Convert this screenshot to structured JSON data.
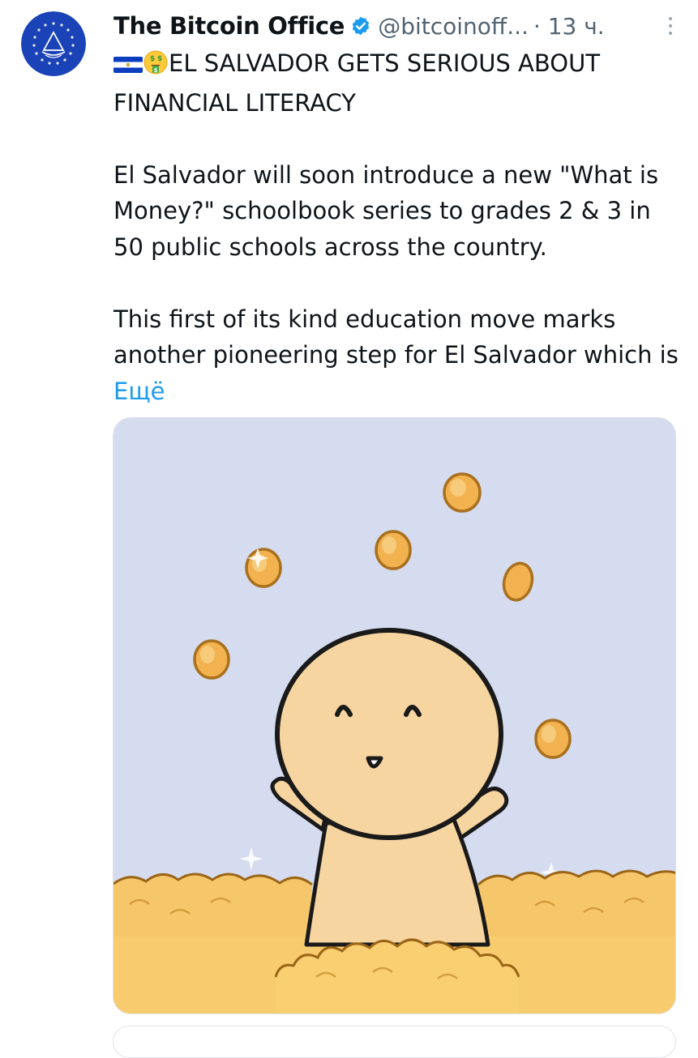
{
  "tweet": {
    "author_name": "The Bitcoin Office",
    "handle": "@bitcoinoff...",
    "time": "· 13 ч.",
    "headline": "EL SALVADOR GETS SERIOUS ABOUT FINANCIAL LITERACY",
    "paragraph_1": "El Salvador will soon introduce a new \"What is Money?\" schoolbook series to grades 2 & 3 in 50 public schools across the country.",
    "paragraph_2": "This first of its kind education move marks another pioneering step for El Salvador which is",
    "more_link": "Ещё"
  },
  "icons": {
    "avatar": "el-salvador-coat-of-arms-avatar",
    "verified": "verified-badge-icon",
    "more": "more-options-icon",
    "flag": "el-salvador-flag-emoji",
    "money_face": "money-mouth-face-emoji"
  },
  "colors": {
    "link": "#1d9bf0",
    "verified": "#1d9bf0",
    "avatar_bg": "#1a43b8",
    "image_sky": "#d6dcef",
    "image_coins": "#f6c76a"
  }
}
